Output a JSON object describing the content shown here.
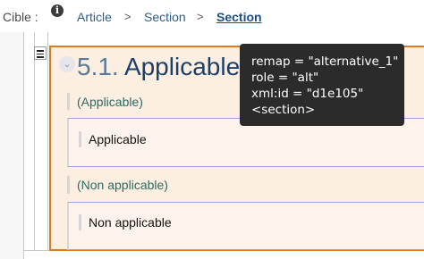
{
  "breadcrumb": {
    "prefix": "Cible :",
    "info_icon": "info-icon",
    "items": [
      {
        "label": "Article"
      },
      {
        "label": "Section"
      },
      {
        "label": "Section"
      }
    ],
    "separator": ">"
  },
  "section": {
    "number": "5.1.",
    "title": "Applicable",
    "collapse_icon": "chevron-down-icon",
    "menu_icon": "hamburger-icon",
    "alternatives": [
      {
        "label": "(Applicable)",
        "content": "Applicable"
      },
      {
        "label": "(Non applicable)",
        "content": "Non applicable"
      }
    ]
  },
  "tooltip": {
    "lines": [
      "remap = \"alternative_1\"",
      "role = \"alt\"",
      "xml:id = \"d1e105\"",
      "<section>"
    ]
  },
  "colors": {
    "section_border": "#e07a1e",
    "section_bg": "#fcefe2",
    "link": "#2d5d86",
    "tooltip_bg": "#2b2b2b"
  }
}
